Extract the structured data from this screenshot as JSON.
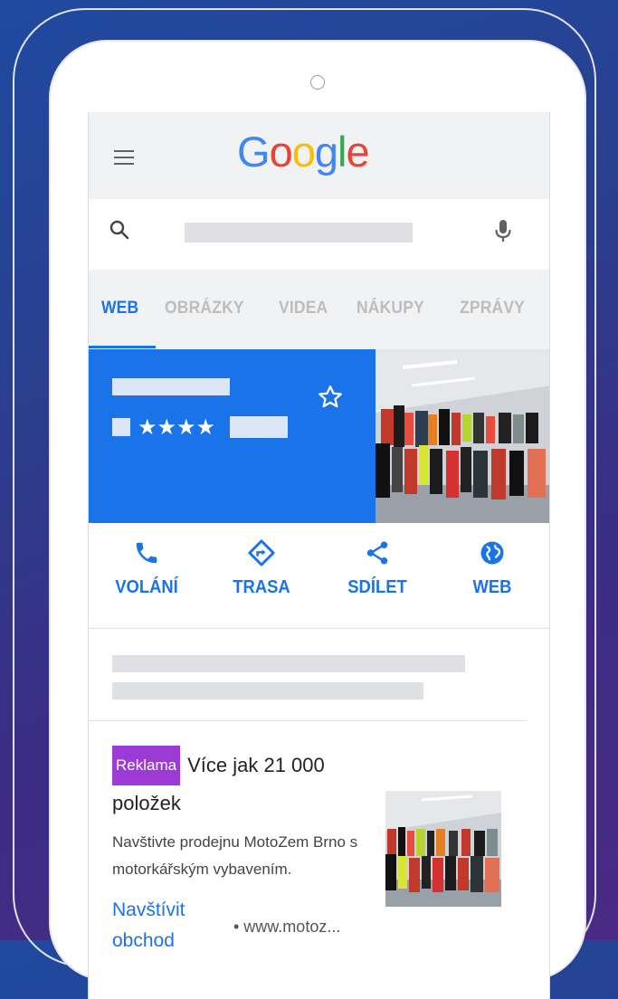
{
  "colors": {
    "accent": "#1a73e8",
    "ad_badge": "#9c3ad6",
    "google": [
      "#4285f4",
      "#ea4335",
      "#fbbc05",
      "#4285f4",
      "#34a853",
      "#ea4335"
    ]
  },
  "header": {
    "logo_letters": [
      "G",
      "o",
      "o",
      "g",
      "l",
      "e"
    ]
  },
  "search": {
    "value": ""
  },
  "tabs": [
    {
      "label": "WEB",
      "active": true
    },
    {
      "label": "OBRÁZKY"
    },
    {
      "label": "VIDEA"
    },
    {
      "label": "NÁKUPY"
    },
    {
      "label": "ZPRÁVY"
    }
  ],
  "business": {
    "stars": "★★★★"
  },
  "actions": [
    {
      "label": "VOLÁNÍ",
      "icon": "phone-icon"
    },
    {
      "label": "TRASA",
      "icon": "directions-icon"
    },
    {
      "label": "SDÍLET",
      "icon": "share-icon"
    },
    {
      "label": "WEB",
      "icon": "globe-icon"
    }
  ],
  "ad": {
    "badge": "Reklama",
    "title": "Více jak 21 000 položek",
    "description": "Navštivte prodejnu MotoZem Brno s motorkářským vybavením.",
    "link": "Navštívit obchod",
    "url": "• www.motoz..."
  }
}
